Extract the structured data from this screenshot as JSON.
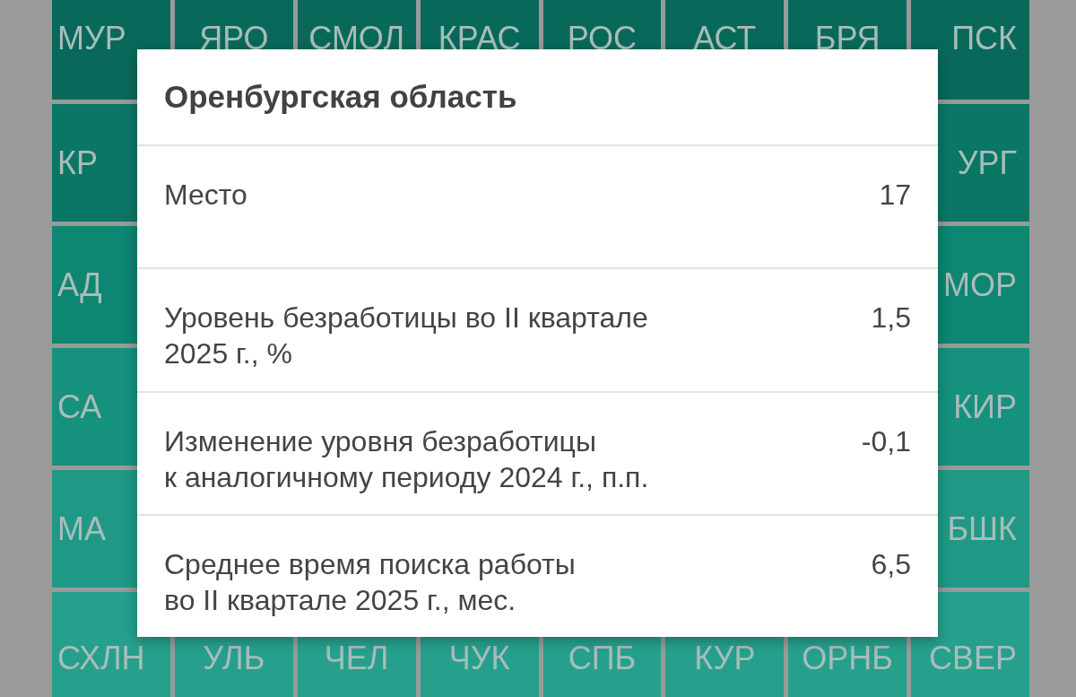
{
  "tile_rows": [
    {
      "tiles": [
        {
          "label": "МУР",
          "color": "#08695b"
        },
        {
          "label": "ЯРО",
          "color": "#08695b"
        },
        {
          "label": "СМОЛ",
          "color": "#08695b"
        },
        {
          "label": "КРАС",
          "color": "#08695b"
        },
        {
          "label": "РОС",
          "color": "#08695b"
        },
        {
          "label": "АСТ",
          "color": "#08695b"
        },
        {
          "label": "БРЯ",
          "color": "#08695b"
        },
        {
          "label": "ПСК",
          "color": "#08695b"
        }
      ]
    },
    {
      "tiles": [
        {
          "label": "КР",
          "color": "#0a7766"
        },
        {
          "label": "УРГ",
          "color": "#0a7766"
        }
      ]
    },
    {
      "tiles": [
        {
          "label": "АД",
          "color": "#0d8672"
        },
        {
          "label": "МОР",
          "color": "#0d8672"
        }
      ]
    },
    {
      "tiles": [
        {
          "label": "СА",
          "color": "#16917e"
        },
        {
          "label": "КИР",
          "color": "#16917e"
        }
      ]
    },
    {
      "tiles": [
        {
          "label": "МА",
          "color": "#1f9986"
        },
        {
          "label": "БШК",
          "color": "#1f9986"
        }
      ]
    },
    {
      "tiles": [
        {
          "label": "СХЛН",
          "color": "#26a08d"
        },
        {
          "label": "УЛЬ",
          "color": "#26a08d"
        },
        {
          "label": "ЧЕЛ",
          "color": "#26a08d"
        },
        {
          "label": "ЧУК",
          "color": "#26a08d"
        },
        {
          "label": "СПБ",
          "color": "#26a08d"
        },
        {
          "label": "КУР",
          "color": "#26a08d"
        },
        {
          "label": "ОРНБ",
          "color": "#26a08d"
        },
        {
          "label": "СВЕР",
          "color": "#26a08d"
        }
      ]
    }
  ],
  "dialog": {
    "title": "Оренбургская область",
    "rows": [
      {
        "label": "Место",
        "value": "17"
      },
      {
        "label": "Уровень безработицы во II квартале\n2025 г., %",
        "value": "1,5"
      },
      {
        "label": "Изменение уровня безработицы\nк аналогичному периоду 2024 г., п.п.",
        "value": "-0,1"
      },
      {
        "label": "Среднее время поиска работы\nво II квартале 2025 г., мес.",
        "value": "6,5"
      }
    ]
  }
}
